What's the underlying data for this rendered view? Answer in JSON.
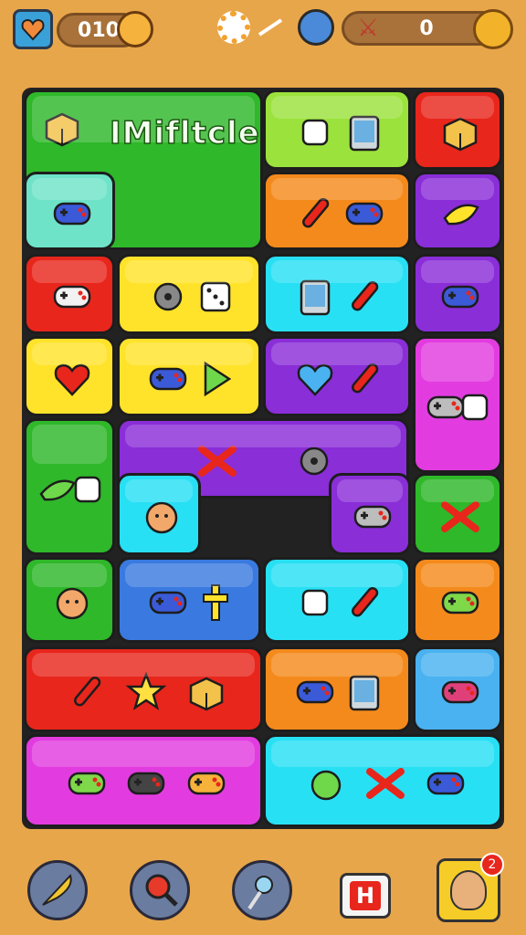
{
  "hud": {
    "left_counter": "010",
    "right_counter": "0"
  },
  "level": {
    "title": "IMifltcle"
  },
  "colors": {
    "green": "#2fb82a",
    "lime": "#9be23c",
    "red": "#e8261c",
    "orange": "#f58a1c",
    "purple": "#8a2ed8",
    "teal": "#6fe3c8",
    "yellow": "#ffe32a",
    "cyan": "#28e0f4",
    "magenta": "#e23ce0",
    "blue": "#3a7ae0",
    "sky": "#4ab2f0"
  },
  "tiles": [
    {
      "color": "green",
      "icons": [
        "checkbox-tablet-icon"
      ]
    },
    {
      "color": "lime",
      "icons": [
        "wrench-icon",
        "tablet-icon"
      ]
    },
    {
      "color": "red",
      "icons": [
        "box-icon"
      ]
    },
    {
      "color": "teal",
      "icons": [
        "gamepad-icon"
      ]
    },
    {
      "color": "green",
      "icons": [
        "plum-icon",
        "heart-icon"
      ]
    },
    {
      "color": "orange",
      "icons": [
        "bottle-icon",
        "controller-icon"
      ]
    },
    {
      "color": "purple",
      "icons": [
        "banana-icon"
      ]
    },
    {
      "color": "red",
      "icons": [
        "gamepad-white-icon"
      ]
    },
    {
      "color": "yellow",
      "icons": [
        "saw-icon",
        "dice-icon"
      ]
    },
    {
      "color": "cyan",
      "icons": [
        "tablet-icon",
        "pen-icon"
      ]
    },
    {
      "color": "purple",
      "icons": [
        "gamepad-icon"
      ]
    },
    {
      "color": "yellow",
      "icons": [
        "heart-icon"
      ]
    },
    {
      "color": "yellow",
      "icons": [
        "switch-icon",
        "play-icon"
      ]
    },
    {
      "color": "purple",
      "icons": [
        "heart-blue-icon",
        "pen-icon"
      ]
    },
    {
      "color": "magenta",
      "icons": [
        "gamepad-grey-icon",
        "joystick-icon"
      ]
    },
    {
      "color": "green",
      "icons": [
        "leaf-icon",
        "pacifier-icon"
      ]
    },
    {
      "color": "purple",
      "icons": [
        "bone-icon",
        "ring-icon"
      ]
    },
    {
      "color": "cyan",
      "icons": [
        "face-icon"
      ]
    },
    {
      "color": "purple",
      "icons": [
        "switch-grey-icon"
      ]
    },
    {
      "color": "green",
      "icons": [
        "ribbon-icon"
      ]
    },
    {
      "color": "green",
      "icons": [
        "creature-icon"
      ]
    },
    {
      "color": "blue",
      "icons": [
        "switch-icon",
        "cross-icon"
      ]
    },
    {
      "color": "cyan",
      "icons": [
        "plant-icon",
        "capsule-icon"
      ]
    },
    {
      "color": "orange",
      "icons": [
        "gamepad-green-icon"
      ]
    },
    {
      "color": "red",
      "icons": [
        "pen-icon",
        "star-icon",
        "box-icon"
      ]
    },
    {
      "color": "orange",
      "icons": [
        "gamepad-icon",
        "phone-icon"
      ]
    },
    {
      "color": "sky",
      "icons": [
        "gamepad-pink-icon"
      ]
    },
    {
      "color": "magenta",
      "icons": [
        "gamepad-green-icon",
        "gamepad-dark-icon",
        "gamepad-yellow-icon"
      ]
    },
    {
      "color": "cyan",
      "icons": [
        "apple-icon",
        "bone-icon",
        "switch-icon"
      ]
    }
  ]
}
